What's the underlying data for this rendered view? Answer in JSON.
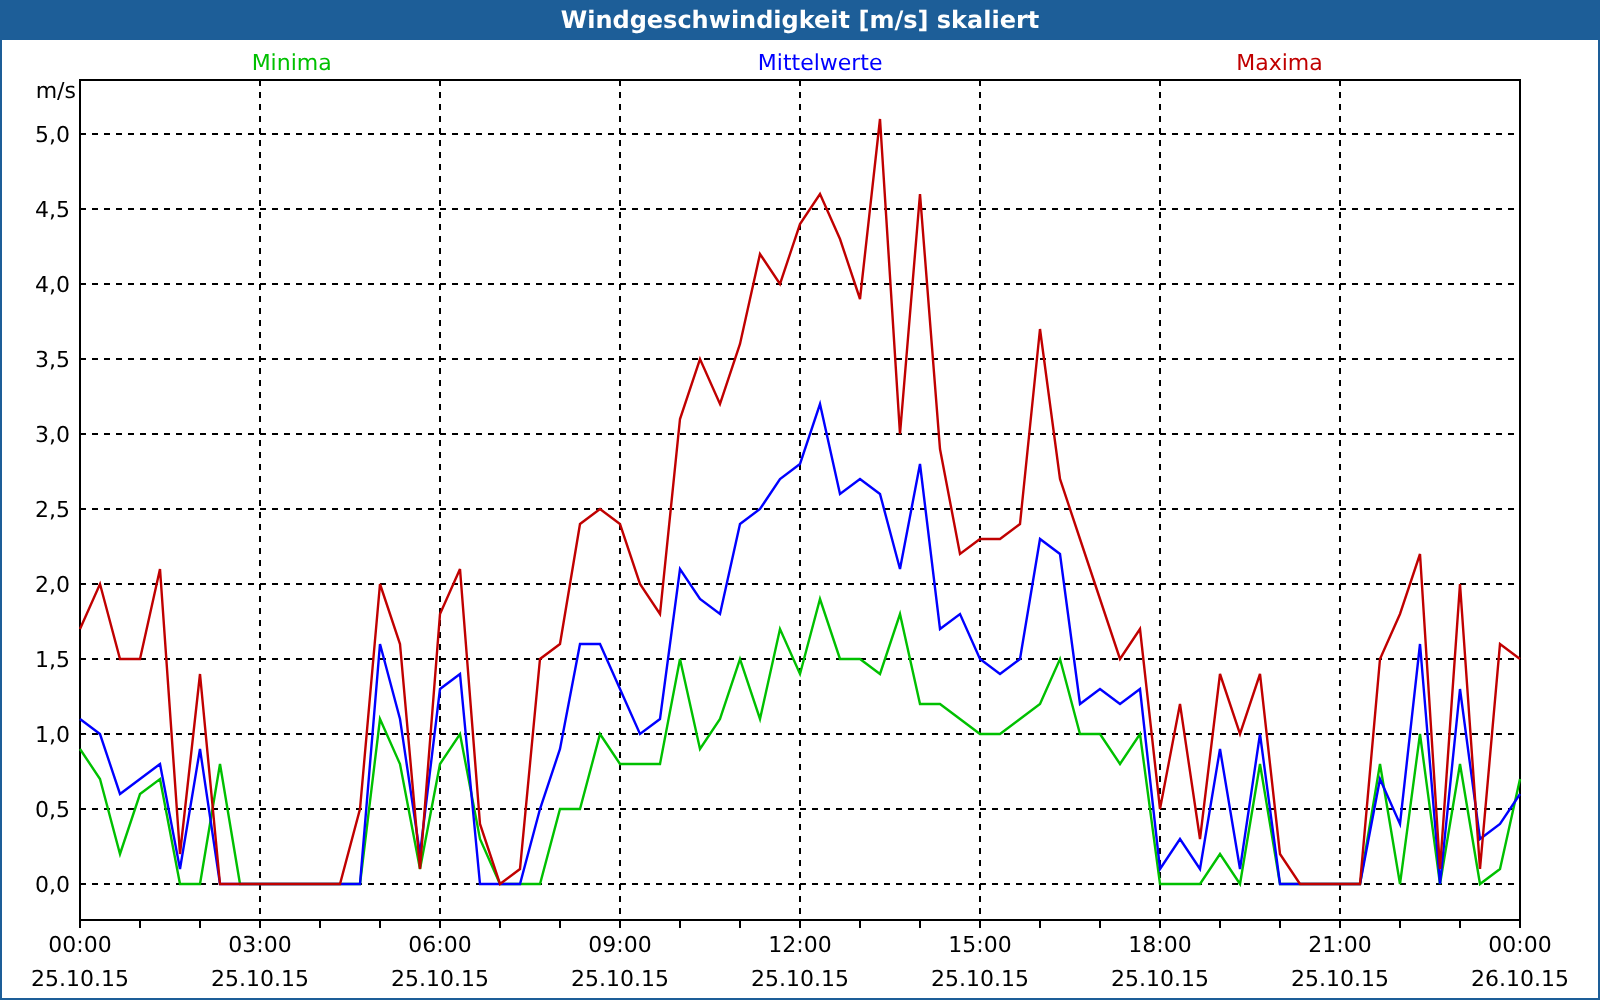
{
  "window": {
    "title": "Windgeschwindigkeit [m/s] skaliert"
  },
  "chart_data": {
    "type": "line",
    "grid": true,
    "ylabel": "m/s",
    "ylim": [
      -0.24,
      5.36
    ],
    "categories": [
      "00:00 25.10.15",
      null,
      null,
      null,
      null,
      null,
      null,
      null,
      null,
      "03:00 25.10.15",
      null,
      null,
      null,
      null,
      null,
      null,
      null,
      null,
      "06:00 25.10.15",
      null,
      null,
      null,
      null,
      null,
      null,
      null,
      null,
      "09:00 25.10.15",
      null,
      null,
      null,
      null,
      null,
      null,
      null,
      null,
      "12:00 25.10.15",
      null,
      null,
      null,
      null,
      null,
      null,
      null,
      null,
      "15:00 25.10.15",
      null,
      null,
      null,
      null,
      null,
      null,
      null,
      null,
      "18:00 25.10.15",
      null,
      null,
      null,
      null,
      null,
      null,
      null,
      null,
      "21:00 25.10.15",
      null,
      null,
      null,
      null,
      null,
      null,
      null,
      null,
      "00:00 26.10.15"
    ],
    "yticks": [
      {
        "value": 0,
        "label": "0,0"
      },
      {
        "value": 0.5,
        "label": "0,5"
      },
      {
        "value": 1,
        "label": "1,0"
      },
      {
        "value": 1.5,
        "label": "1,5"
      },
      {
        "value": 2,
        "label": "2,0"
      },
      {
        "value": 2.5,
        "label": "2,5"
      },
      {
        "value": 3,
        "label": "3,0"
      },
      {
        "value": 3.5,
        "label": "3,5"
      },
      {
        "value": 4,
        "label": "4,0"
      },
      {
        "value": 4.5,
        "label": "4,5"
      },
      {
        "value": 5,
        "label": "5,0"
      }
    ],
    "series": [
      {
        "name": "Minima",
        "color": "#00c000",
        "values": [
          0.9,
          0.7,
          0.2,
          0.6,
          0.7,
          0,
          0,
          0.8,
          0,
          0,
          0,
          0,
          0,
          0,
          0,
          1.1,
          0.8,
          0.1,
          0.8,
          1.0,
          0.3,
          0,
          0,
          0,
          0.5,
          0.5,
          1.0,
          0.8,
          0.8,
          0.8,
          1.5,
          0.9,
          1.1,
          1.5,
          1.1,
          1.7,
          1.4,
          1.9,
          1.5,
          1.5,
          1.4,
          1.8,
          1.2,
          1.2,
          1.1,
          1.0,
          1.0,
          1.1,
          1.2,
          1.5,
          1.0,
          1.0,
          0.8,
          1.0,
          0,
          0,
          0,
          0.2,
          0,
          0.8,
          0,
          0,
          0,
          0,
          0,
          0.8,
          0,
          1.0,
          0,
          0.8,
          0,
          0.1,
          0.7
        ]
      },
      {
        "name": "Mittelwerte",
        "color": "#0000ff",
        "values": [
          1.1,
          1.0,
          0.6,
          0.7,
          0.8,
          0.1,
          0.9,
          0,
          0,
          0,
          0,
          0,
          0,
          0,
          0,
          1.6,
          1.1,
          0.2,
          1.3,
          1.4,
          0,
          0,
          0,
          0.5,
          0.9,
          1.6,
          1.6,
          1.3,
          1.0,
          1.1,
          2.1,
          1.9,
          1.8,
          2.4,
          2.5,
          2.7,
          2.8,
          3.2,
          2.6,
          2.7,
          2.6,
          2.1,
          2.8,
          1.7,
          1.8,
          1.5,
          1.4,
          1.5,
          2.3,
          2.2,
          1.2,
          1.3,
          1.2,
          1.3,
          0.1,
          0.3,
          0.1,
          0.9,
          0.1,
          1.0,
          0,
          0,
          0,
          0,
          0,
          0.7,
          0.4,
          1.6,
          0,
          1.3,
          0.3,
          0.4,
          0.6
        ]
      },
      {
        "name": "Maxima",
        "color": "#c00000",
        "values": [
          1.7,
          2.0,
          1.5,
          1.5,
          2.1,
          0.2,
          1.4,
          0,
          0,
          0,
          0,
          0,
          0,
          0,
          0.5,
          2.0,
          1.6,
          0.1,
          1.8,
          2.1,
          0.4,
          0,
          0.1,
          1.5,
          1.6,
          2.4,
          2.5,
          2.4,
          2.0,
          1.8,
          3.1,
          3.5,
          3.2,
          3.6,
          4.2,
          4.0,
          4.4,
          4.6,
          4.3,
          3.9,
          5.1,
          3.0,
          4.6,
          2.9,
          2.2,
          2.3,
          2.3,
          2.4,
          3.7,
          2.7,
          2.3,
          1.9,
          1.5,
          1.7,
          0.5,
          1.2,
          0.3,
          1.4,
          1.0,
          1.4,
          0.2,
          0,
          0,
          0,
          0,
          1.5,
          1.8,
          2.2,
          0.1,
          2.0,
          0.1,
          1.6,
          1.5
        ]
      }
    ]
  }
}
